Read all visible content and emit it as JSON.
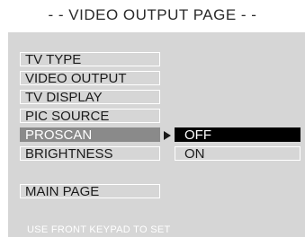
{
  "header": {
    "title": "- - VIDEO OUTPUT PAGE - -"
  },
  "menu": {
    "items": [
      {
        "label": "TV TYPE"
      },
      {
        "label": "VIDEO OUTPUT"
      },
      {
        "label": "TV DISPLAY"
      },
      {
        "label": "PIC SOURCE"
      },
      {
        "label": "PROSCAN",
        "active": true
      },
      {
        "label": "BRIGHTNESS"
      }
    ],
    "main_page": "MAIN PAGE"
  },
  "submenu": {
    "options": [
      {
        "label": "OFF",
        "selected": true
      },
      {
        "label": "ON"
      }
    ]
  },
  "footer": {
    "hint": "USE FRONT KEYPAD TO SET"
  },
  "colors": {
    "background": "#d6d6d6",
    "highlight": "#8a8a8a",
    "selected": "#000000",
    "border": "#ffffff"
  }
}
